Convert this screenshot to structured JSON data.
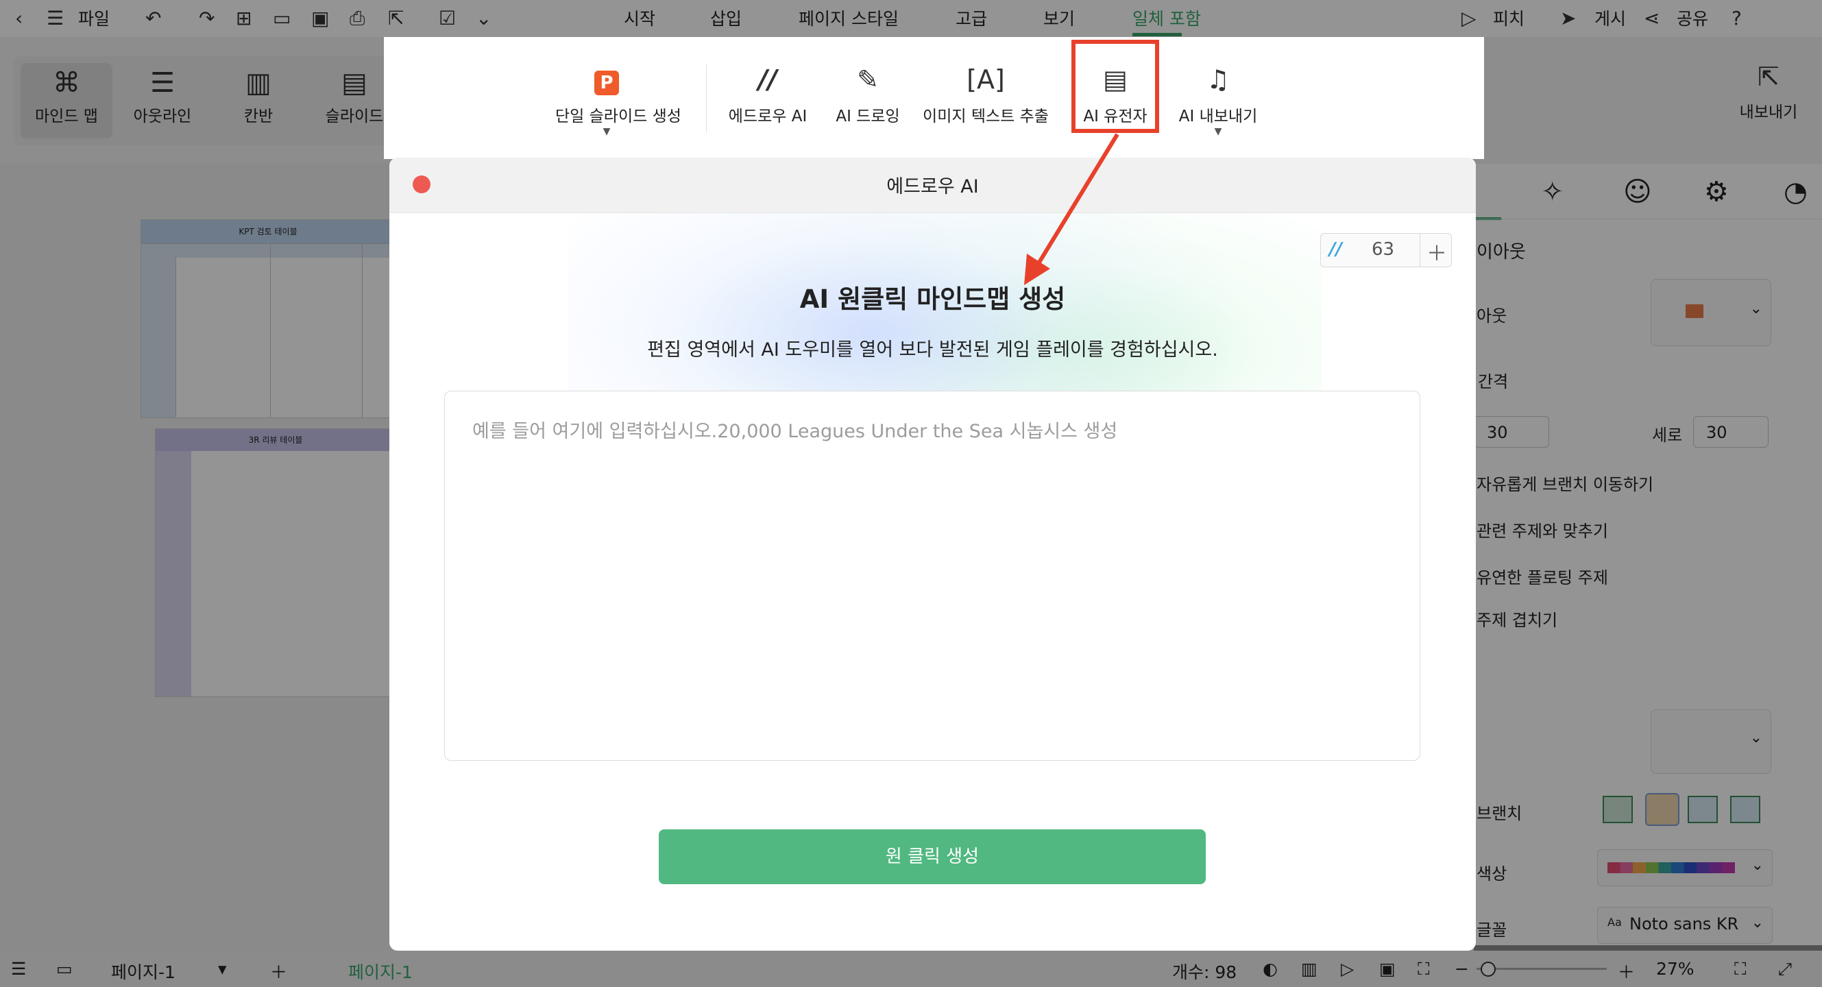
{
  "menubar": {
    "file": "파일",
    "tabs": [
      "시작",
      "삽입",
      "페이지 스타일",
      "고급",
      "보기",
      "일체 포함"
    ],
    "active_tab": "일체 포함",
    "accent": "#3aa66b",
    "pitch": "피치",
    "publish": "게시",
    "share": "공유",
    "help_icon": "question-icon"
  },
  "leftnav": {
    "items": [
      {
        "label": "마인드 맵",
        "icon": "mindmap-icon"
      },
      {
        "label": "아웃라인",
        "icon": "outline-icon"
      },
      {
        "label": "칸반",
        "icon": "kanban-icon"
      },
      {
        "label": "슬라이드",
        "icon": "slide-icon"
      }
    ]
  },
  "ai_toolbar": {
    "items": [
      {
        "label": "단일 슬라이드 생성",
        "icon": "ppt-icon"
      },
      {
        "label": "에드로우 AI",
        "icon": "edraw-ai-icon"
      },
      {
        "label": "AI 드로잉",
        "icon": "ai-drawing-icon"
      },
      {
        "label": "이미지 텍스트 추출",
        "icon": "ocr-icon"
      },
      {
        "label": "AI 유전자",
        "icon": "ai-gene-icon"
      },
      {
        "label": "AI 내보내기",
        "icon": "ai-export-icon"
      }
    ],
    "highlight_color": "#e8412b"
  },
  "export_button": "내보내기",
  "canvas": {
    "table1_title": "KPT 검토 테이블",
    "table2_title": "3R 리뷰 테이블"
  },
  "dialog": {
    "title": "에드로우 AI",
    "credits": "63",
    "headline": "AI 원클릭 마인드맵 생성",
    "subline": "편집 영역에서 AI 도우미를 열어 보다 발전된 게임 플레이를 경험하십시오.",
    "placeholder": "예를 들어 여기에 입력하십시오.20,000 Leagues Under the Sea 시놉시스 생성",
    "generate": "원 클릭 생성",
    "button_color": "#50b880"
  },
  "right_panel": {
    "layout_title": "이아웃",
    "layout_label": "아웃",
    "spacing": "간격",
    "horizontal_value": "30",
    "vertical_label": "세로",
    "vertical_value": "30",
    "opt1": "자유롭게 브랜치 이동하기",
    "opt2": "관련 주제와 맞추기",
    "opt3": "유연한 플로팅 주제",
    "opt4": "주제 겹치기",
    "branch": "브랜치",
    "color": "색상",
    "font": "글꼴",
    "font_value": "Noto sans KR"
  },
  "statusbar": {
    "page_select": "페이지-1",
    "page_tab": "페이지-1",
    "count": "개수: 98",
    "zoom": "27%"
  }
}
